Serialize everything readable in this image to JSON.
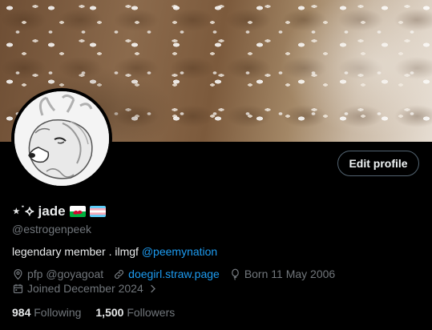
{
  "profile": {
    "display_name_prefix": "⋆˙⟡",
    "display_name": "jade",
    "handle": "@estrogenpeek",
    "bio_text": "legendary member . ilmgf ",
    "bio_mention": "@peemynation",
    "location": "pfp @goyagoat",
    "website": "doegirl.straw.page",
    "birthday": "Born 11 May 2006",
    "joined": "Joined December 2024"
  },
  "actions": {
    "edit_profile_label": "Edit profile"
  },
  "stats": {
    "following_count": "984",
    "following_label": "Following",
    "followers_count": "1,500",
    "followers_label": "Followers"
  },
  "colors": {
    "background": "#000000",
    "accent_link": "#1d9bf0",
    "secondary_text": "#71767b",
    "primary_text": "#e7e9ea"
  },
  "icons": [
    "location-icon",
    "link-icon",
    "balloon-icon",
    "calendar-icon",
    "chevron-right-icon",
    "wales-flag-icon",
    "trans-flag-icon"
  ]
}
